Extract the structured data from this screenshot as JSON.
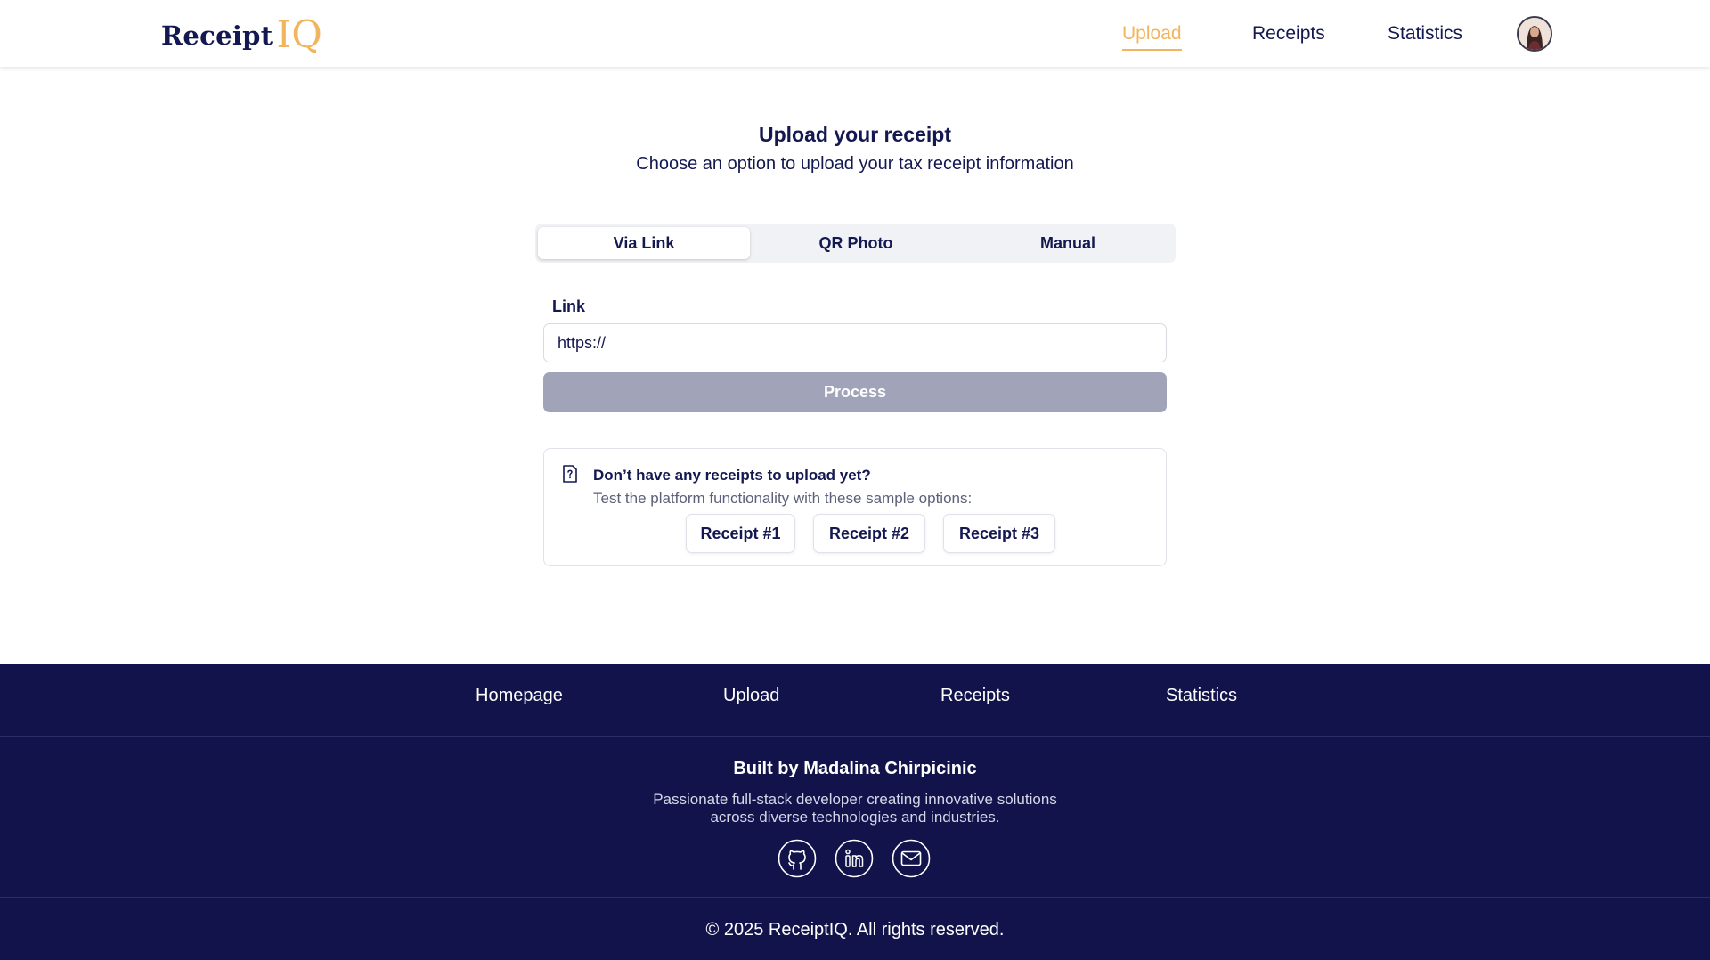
{
  "brand": {
    "name_main": "Receipt",
    "name_accent": "IQ",
    "accent_color": "#f2b45c",
    "primary_color": "#141850"
  },
  "nav": {
    "upload": "Upload",
    "receipts": "Receipts",
    "statistics": "Statistics"
  },
  "avatar_icon": "user-avatar",
  "main": {
    "title": "Upload your receipt",
    "subtitle": "Choose an option to upload your tax receipt information",
    "tabs": [
      "Via Link",
      "QR Photo",
      "Manual"
    ],
    "active_tab": "Via Link",
    "link_label": "Link",
    "link_value": "https://",
    "process_label": "Process",
    "process_color": "#a1a3b8"
  },
  "samples": {
    "icon": "document-question-icon",
    "heading": "Don’t have any receipts to upload yet?",
    "subtext": "Test the platform functionality with these sample options:",
    "buttons": [
      "Receipt #1",
      "Receipt #2",
      "Receipt #3"
    ]
  },
  "footer": {
    "background": "#11134a",
    "links": [
      "Homepage",
      "Upload",
      "Receipts",
      "Statistics"
    ],
    "built_by": "Built by Madalina Chirpicinic",
    "bio_line1": "Passionate full-stack developer creating innovative solutions",
    "bio_line2": "across diverse technologies and industries.",
    "social_icons": [
      "github-icon",
      "linkedin-icon",
      "mail-icon"
    ],
    "copyright": "© 2025 ReceiptIQ. All rights reserved."
  }
}
